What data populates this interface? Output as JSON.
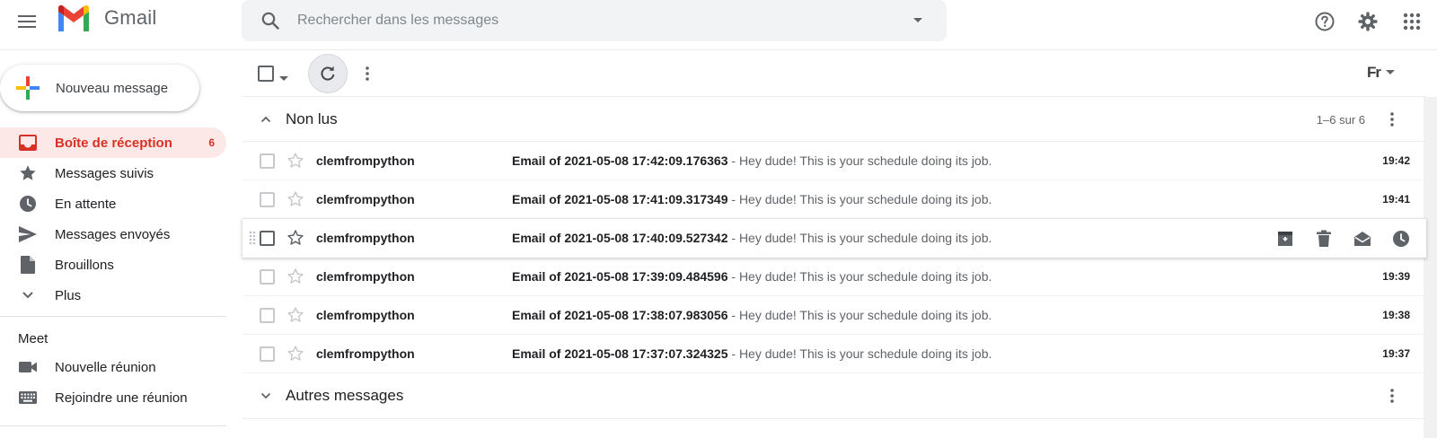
{
  "colors": {
    "accent_red": "#d93025",
    "active_bg": "#fce8e6",
    "icon_grey": "#5f6368",
    "search_bg": "#f1f3f4"
  },
  "header": {
    "app_name": "Gmail",
    "menu_icon": "hamburger-icon",
    "logo_icon": "gmail-m-logo",
    "search": {
      "icon": "search-icon",
      "placeholder": "Rechercher dans les messages",
      "value": "",
      "options_icon": "caret-down-icon"
    },
    "right_icons": [
      "help-icon",
      "settings-gear-icon",
      "apps-grid-icon"
    ]
  },
  "sidebar": {
    "compose_label": "Nouveau message",
    "items": [
      {
        "label": "Boîte de réception",
        "icon": "inbox-icon",
        "count": "6",
        "active": true
      },
      {
        "label": "Messages suivis",
        "icon": "star-icon",
        "count": "",
        "active": false
      },
      {
        "label": "En attente",
        "icon": "clock-icon",
        "count": "",
        "active": false
      },
      {
        "label": "Messages envoyés",
        "icon": "send-icon",
        "count": "",
        "active": false
      },
      {
        "label": "Brouillons",
        "icon": "draft-icon",
        "count": "",
        "active": false
      },
      {
        "label": "Plus",
        "icon": "chevron-down-icon",
        "count": "",
        "active": false
      }
    ],
    "meet": {
      "title": "Meet",
      "items": [
        {
          "label": "Nouvelle réunion",
          "icon": "videocam-icon"
        },
        {
          "label": "Rejoindre une réunion",
          "icon": "keyboard-icon"
        }
      ]
    }
  },
  "toolbar": {
    "select_icon": "checkbox-icon",
    "refresh_icon": "refresh-icon",
    "more_icon": "more-vert-icon",
    "input_tools_label": "Fr"
  },
  "sections": {
    "unread": {
      "title": "Non lus",
      "range": "1–6 sur 6"
    },
    "other": {
      "title": "Autres messages"
    }
  },
  "emails": [
    {
      "sender": "clemfrompython",
      "subject": "Email of 2021-05-08 17:42:09.176363",
      "snippet": " - Hey dude! This is your schedule doing its job.",
      "time": "19:42",
      "hovered": false
    },
    {
      "sender": "clemfrompython",
      "subject": "Email of 2021-05-08 17:41:09.317349",
      "snippet": " - Hey dude! This is your schedule doing its job.",
      "time": "19:41",
      "hovered": false
    },
    {
      "sender": "clemfrompython",
      "subject": "Email of 2021-05-08 17:40:09.527342",
      "snippet": " - Hey dude! This is your schedule doing its job.",
      "time": "",
      "hovered": true
    },
    {
      "sender": "clemfrompython",
      "subject": "Email of 2021-05-08 17:39:09.484596",
      "snippet": " - Hey dude! This is your schedule doing its job.",
      "time": "19:39",
      "hovered": false
    },
    {
      "sender": "clemfrompython",
      "subject": "Email of 2021-05-08 17:38:07.983056",
      "snippet": " - Hey dude! This is your schedule doing its job.",
      "time": "19:38",
      "hovered": false
    },
    {
      "sender": "clemfrompython",
      "subject": "Email of 2021-05-08 17:37:07.324325",
      "snippet": " - Hey dude! This is your schedule doing its job.",
      "time": "19:37",
      "hovered": false
    }
  ],
  "hover_actions": [
    "archive-icon",
    "trash-icon",
    "mark-as-read-icon",
    "snooze-icon"
  ]
}
